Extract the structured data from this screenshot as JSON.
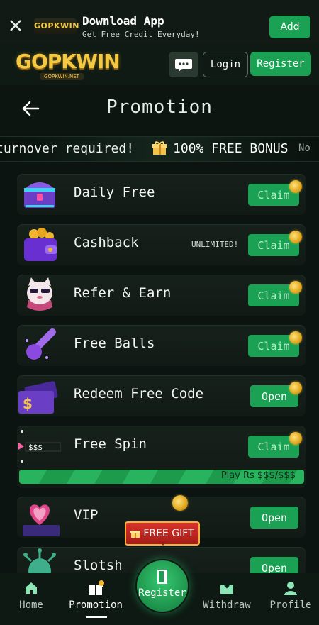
{
  "banner": {
    "logo_text": "GOPKWIN",
    "title": "Download App",
    "subtitle": "Get Free Credit Everyday!",
    "add_label": "Add"
  },
  "header": {
    "logo_text": "GOPKWIN",
    "logo_sub": "GOPKWIN.NET",
    "login_label": "Login",
    "register_label": "Register"
  },
  "page": {
    "title": "Promotion"
  },
  "marquee": {
    "left_text": "turnover required!",
    "bonus_text": "100% FREE BONUS",
    "tail_text": "No"
  },
  "promotions": [
    {
      "label": "Daily Free",
      "tag": "",
      "button": "Claim",
      "icon": "treasure-chest-icon"
    },
    {
      "label": "Cashback",
      "tag": "UNLIMITED!",
      "button": "Claim",
      "icon": "wallet-icon"
    },
    {
      "label": "Refer & Earn",
      "tag": "",
      "button": "Claim",
      "icon": "lucky-cat-icon"
    },
    {
      "label": "Free Balls",
      "tag": "",
      "button": "Claim",
      "icon": "comet-ball-icon"
    },
    {
      "label": "Redeem Free Code",
      "tag": "",
      "button": "Open",
      "icon": "ticket-icon"
    },
    {
      "label": "Free Spin",
      "tag": "",
      "button": "Claim",
      "icon": "slot-reel-icon"
    },
    {
      "label": "VIP",
      "tag": "",
      "button": "Open",
      "icon": "heart-trophy-icon"
    },
    {
      "label": "Slotsh",
      "tag": "",
      "button": "Open",
      "icon": "alien-icon"
    }
  ],
  "free_spin_progress": {
    "text": "Play Rs $$$/$$$",
    "fraction": 1.0
  },
  "floating": {
    "free_gift_label": "FREE GIFT"
  },
  "nav": {
    "home": "Home",
    "promotion": "Promotion",
    "register": "Register",
    "withdraw": "Withdraw",
    "profile": "Profile"
  },
  "colors": {
    "accent": "#1aa153",
    "background": "#0b1410",
    "gold": "#f5c842"
  }
}
